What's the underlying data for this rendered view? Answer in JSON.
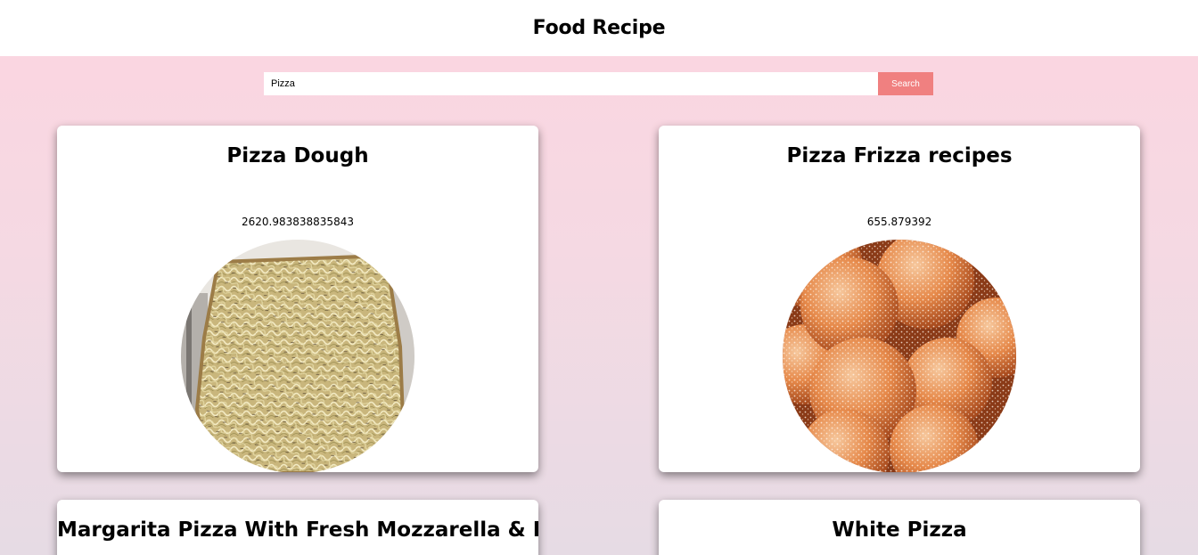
{
  "header": {
    "title": "Food Recipe"
  },
  "search": {
    "value": "Pizza",
    "button_label": "Search"
  },
  "recipes": [
    {
      "title": "Pizza Dough",
      "value": "2620.983838835843",
      "image": "pizza-dough-photo"
    },
    {
      "title": "Pizza Frizza recipes",
      "value": "655.879392",
      "image": "sugared-fried-dough-photo"
    },
    {
      "title": "Margarita Pizza With Fresh Mozzarella & Basil",
      "value": "",
      "image": ""
    },
    {
      "title": "White Pizza",
      "value": "",
      "image": ""
    }
  ],
  "colors": {
    "accent": "#f08080",
    "background_top": "#fcd5e0",
    "background_bottom": "#e6dbe4"
  }
}
